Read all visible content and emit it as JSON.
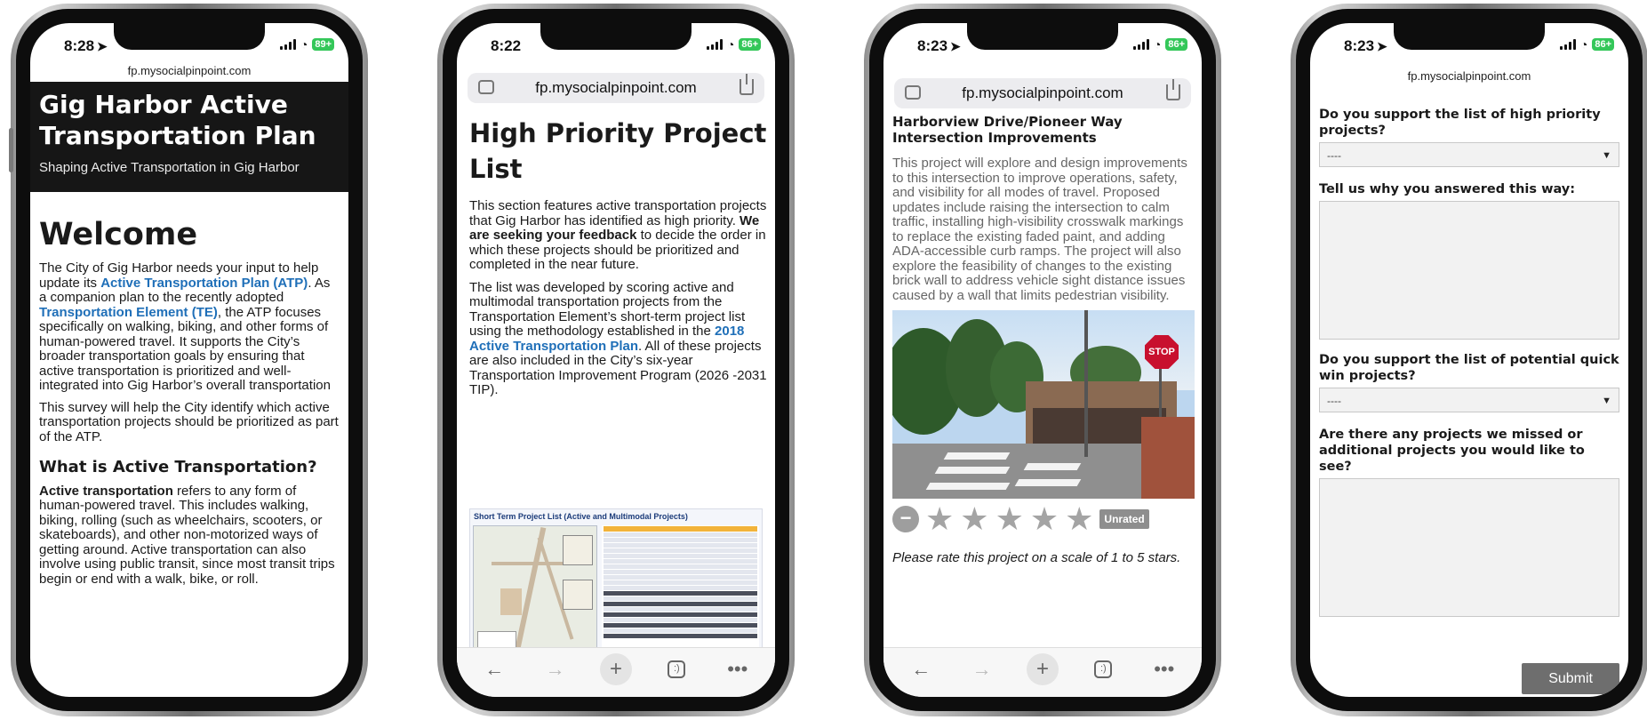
{
  "status_icons": {
    "signal": "signal-icon",
    "wifi": "wifi-icon",
    "battery": "battery-icon",
    "location": "location-arrow-icon"
  },
  "phones": [
    {
      "time": "8:28",
      "battery": "89+",
      "url": "fp.mysocialpinpoint.com",
      "header_title": "Gig Harbor Active Transportation Plan",
      "header_subtitle": "Shaping Active Transportation in Gig Harbor",
      "welcome": "Welcome",
      "p1_a": "The City of Gig Harbor needs your input to help update its ",
      "atp_link": "Active Transportation Plan (ATP)",
      "p1_b": ". As a companion plan to the recently adopted ",
      "te_link": "Transportation Element (TE)",
      "p1_c": ", the ATP focuses specifically on walking, biking, and other forms of human-powered travel. It supports the City’s broader transportation goals by ensuring that active transportation is prioritized and well-integrated into Gig Harbor’s overall transportation",
      "p2": "This survey will help the City identify which active transportation projects should be prioritized as part of the ATP.",
      "h2": "What is Active Transportation?",
      "p3_bold": "Active transportation",
      "p3_rest": " refers to any form of human-powered travel. This includes walking, biking, rolling (such as wheelchairs, scooters, or skateboards), and other non-motorized ways of getting around. Active transportation can also involve using public transit, since most transit trips begin or end with a walk, bike, or roll."
    },
    {
      "time": "8:22",
      "battery": "86+",
      "url": "fp.mysocialpinpoint.com",
      "title": "High Priority Project List",
      "p1_a": "This section features active transportation projects that Gig Harbor has identified as high priority. ",
      "p1_bold": "We are seeking your feedback",
      "p1_b": " to decide the order in which these projects should be prioritized and completed in the near future.",
      "p2_a": "The list was developed by scoring active and multimodal transportation projects from the Transportation Element’s short-term project list using the methodology established in the ",
      "p2_link": "2018 Active Transportation Plan",
      "p2_b": ". All of these projects are also included in the City’s six-year Transportation Improvement Program (2026 -2031 TIP).",
      "figure_title": "Short Term Project List (Active and Multimodal Projects)"
    },
    {
      "time": "8:23",
      "battery": "86+",
      "url": "fp.mysocialpinpoint.com",
      "project_title": "Harborview Drive/Pioneer Way Intersection Improvements",
      "description": "This project will explore and design improvements to this intersection to improve operations, safety, and visibility for all modes of travel. Proposed updates include raising the intersection to calm traffic, installing high-visibility crosswalk markings to replace the existing faded paint, and adding ADA-accessible curb ramps. The project will also explore the feasibility of changes to the existing brick wall to address vehicle sight distance issues caused by a wall that limits pedestrian visibility.",
      "stop_sign": "STOP",
      "rating_value": 0,
      "rating_max": 5,
      "unrated": "Unrated",
      "hint": "Please rate this project on a scale of 1 to 5 stars."
    },
    {
      "time": "8:23",
      "battery": "86+",
      "url": "fp.mysocialpinpoint.com",
      "q1": "Do you support the list of high priority projects?",
      "q1_value": "----",
      "q2": "Tell us why you answered this way:",
      "q3": "Do you support the list of potential quick win projects?",
      "q3_value": "----",
      "q4": "Are there any projects we missed or additional projects you would like to see?",
      "submit": "Submit"
    }
  ],
  "nav": {
    "back": "←",
    "forward": "→",
    "new_tab": "+",
    "tabs": ":)",
    "more": "•••"
  }
}
